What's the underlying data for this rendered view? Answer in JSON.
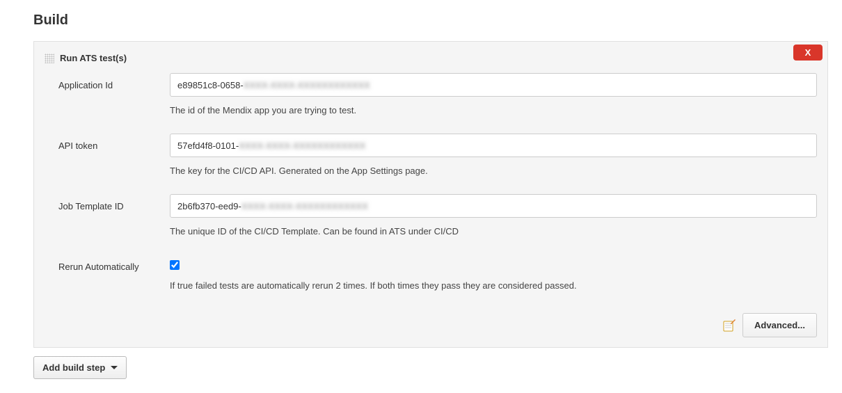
{
  "section": {
    "title": "Build"
  },
  "build_step": {
    "title": "Run ATS test(s)",
    "close_label": "X",
    "fields": {
      "application_id": {
        "label": "Application Id",
        "value_visible": "e89851c8-0658-",
        "value_blurred": "XXXX-XXXX-XXXXXXXXXXXX",
        "help": "The id of the Mendix app you are trying to test."
      },
      "api_token": {
        "label": "API token",
        "value_visible": "57efd4f8-0101-",
        "value_blurred": "XXXX-XXXX-XXXXXXXXXXXX",
        "help": "The key for the CI/CD API. Generated on the App Settings page."
      },
      "job_template_id": {
        "label": "Job Template ID",
        "value_visible": "2b6fb370-eed9-",
        "value_blurred": "XXXX-XXXX-XXXXXXXXXXXX",
        "help": "The unique ID of the CI/CD Template. Can be found in ATS under CI/CD"
      },
      "rerun_automatically": {
        "label": "Rerun Automatically",
        "checked": true,
        "help": "If true failed tests are automatically rerun 2 times. If both times they pass they are considered passed."
      }
    },
    "advanced_label": "Advanced..."
  },
  "add_step_label": "Add build step"
}
